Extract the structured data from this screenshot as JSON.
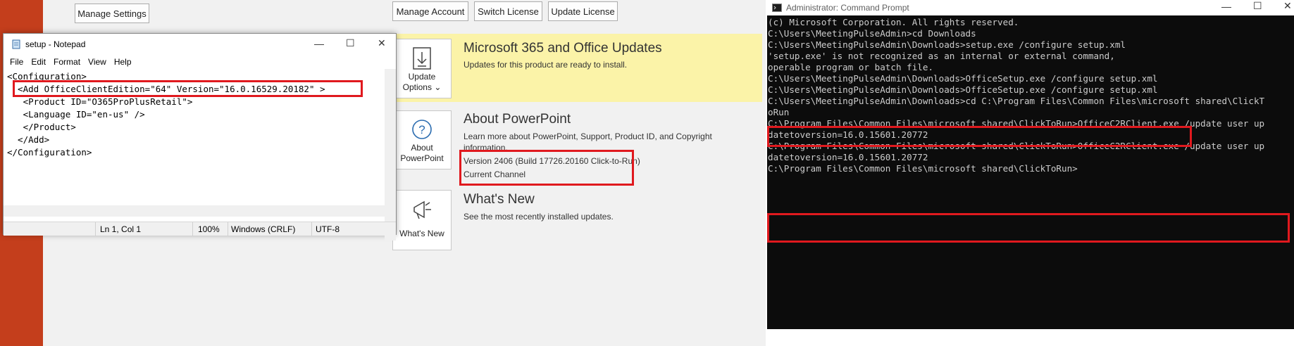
{
  "powerpoint": {
    "buttons": {
      "manage_settings": "Manage Settings",
      "manage_account": "Manage Account",
      "switch_license": "Switch License",
      "update_license": "Update License"
    },
    "updates": {
      "tile_label_1": "Update",
      "tile_label_2": "Options",
      "tile_chevron": "⌄",
      "title": "Microsoft 365 and Office Updates",
      "description": "Updates for this product are ready to install."
    },
    "about": {
      "tile_label_1": "About",
      "tile_label_2": "PowerPoint",
      "title": "About PowerPoint",
      "description_1": "Learn more about PowerPoint, Support, Product ID, and Copyright",
      "description_2": "information.",
      "version": "Version 2406 (Build 17726.20160 Click-to-Run)",
      "channel": "Current Channel"
    },
    "whats_new": {
      "tile_label": "What's New",
      "title": "What's New",
      "description": "See the most recently installed updates."
    }
  },
  "notepad": {
    "title": "setup - Notepad",
    "menu": [
      "File",
      "Edit",
      "Format",
      "View",
      "Help"
    ],
    "lines": [
      "<Configuration>",
      "  <Add OfficeClientEdition=\"64\" Version=\"16.0.16529.20182\" >",
      "   <Product ID=\"O365ProPlusRetail\">",
      "   <Language ID=\"en-us\" />",
      "   </Product>",
      "  </Add>",
      "</Configuration>"
    ],
    "status": {
      "position": "Ln 1, Col 1",
      "zoom": "100%",
      "line_ending": "Windows (CRLF)",
      "encoding": "UTF-8"
    }
  },
  "cmd": {
    "title": "Administrator: Command Prompt",
    "lines": [
      "(c) Microsoft Corporation. All rights reserved.",
      "",
      "C:\\Users\\MeetingPulseAdmin>cd Downloads",
      "",
      "C:\\Users\\MeetingPulseAdmin\\Downloads>setup.exe /configure setup.xml",
      "'setup.exe' is not recognized as an internal or external command,",
      "operable program or batch file.",
      "",
      "C:\\Users\\MeetingPulseAdmin\\Downloads>OfficeSetup.exe /configure setup.xml",
      "",
      "C:\\Users\\MeetingPulseAdmin\\Downloads>OfficeSetup.exe /configure setup.xml",
      "",
      "C:\\Users\\MeetingPulseAdmin\\Downloads>cd C:\\Program Files\\Common Files\\microsoft shared\\ClickT",
      "oRun",
      "",
      "C:\\Program Files\\Common Files\\microsoft shared\\ClickToRun>OfficeC2RClient.exe /update user up",
      "datetoversion=16.0.15601.20772",
      "",
      "C:\\Program Files\\Common Files\\microsoft shared\\ClickToRun>OfficeC2RClient.exe /update user up",
      "datetoversion=16.0.15601.20772",
      "",
      "C:\\Program Files\\Common Files\\microsoft shared\\ClickToRun>"
    ]
  },
  "icons": {
    "minimize": "—",
    "maximize": "☐",
    "close": "✕"
  },
  "colors": {
    "highlight": "#e0191e",
    "banner": "#fbf3a8",
    "ppt_brand": "#c43e1c"
  }
}
